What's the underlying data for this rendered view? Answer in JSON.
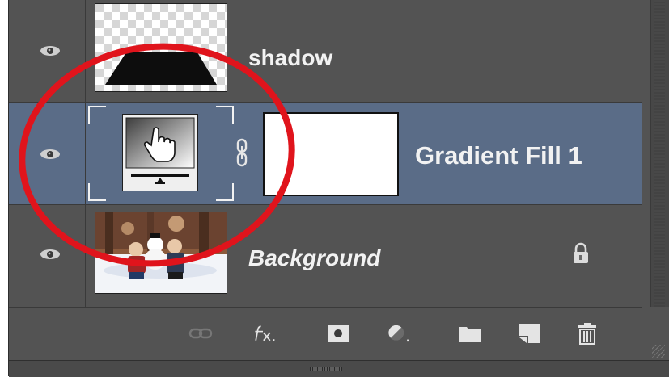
{
  "layers": [
    {
      "name": "shadow",
      "italic": false,
      "selected": false,
      "thumbnail": "shadow-shape-thumbnail"
    },
    {
      "name": "Gradient Fill 1",
      "italic": false,
      "selected": true,
      "thumbnail": "gradient-fill-adjustment-thumbnail",
      "mask": "white-layer-mask"
    },
    {
      "name": "Background",
      "italic": true,
      "selected": false,
      "thumbnail": "photo-thumbnail",
      "locked": true
    }
  ],
  "toolbar": {
    "icons": [
      "link-layers-icon",
      "fx-layer-style-icon",
      "add-mask-icon",
      "adjustment-layer-icon",
      "new-group-icon",
      "new-layer-icon",
      "delete-layer-icon"
    ]
  },
  "colors": {
    "panel": "#535353",
    "selected_row": "#5a6c87",
    "annotation": "#e0141c"
  }
}
